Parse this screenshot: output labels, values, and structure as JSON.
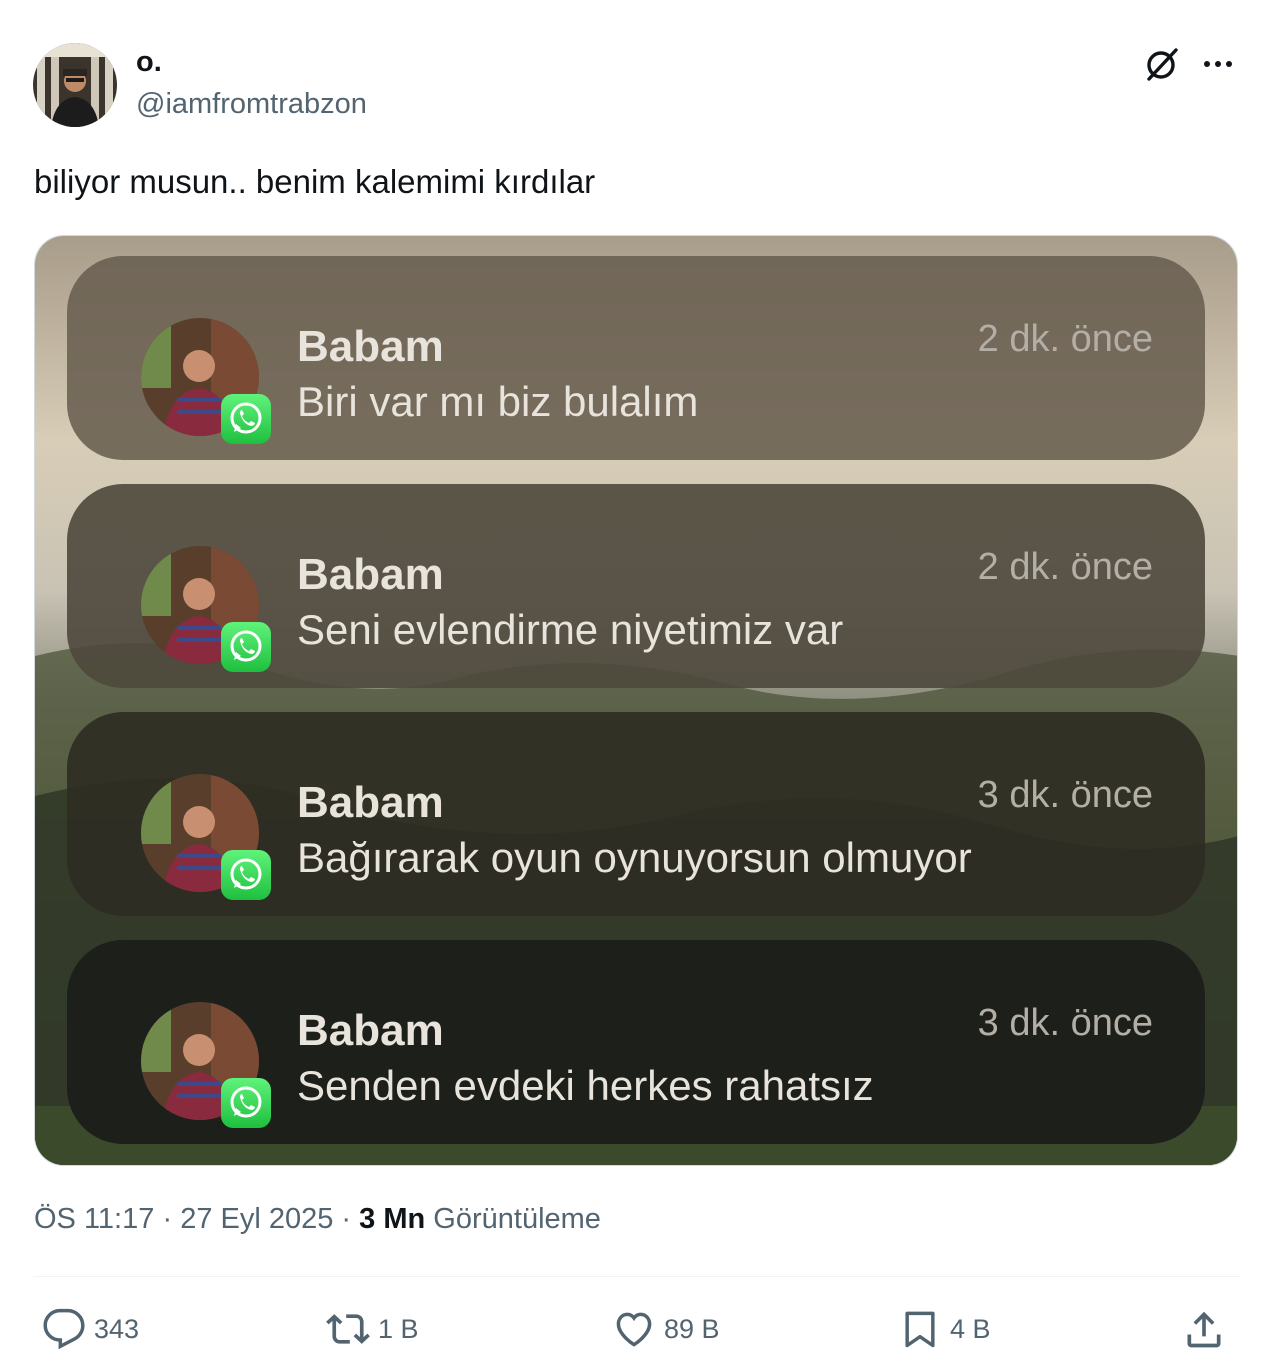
{
  "author": {
    "name": "o.",
    "handle": "@iamfromtrabzon"
  },
  "tweet": {
    "text": "biliyor musun.. benim kalemimi kırdılar"
  },
  "media": {
    "notifications": [
      {
        "sender": "Babam",
        "message": "Biri var mı biz bulalım",
        "time": "2 dk. önce",
        "app_icon": "whatsapp-icon"
      },
      {
        "sender": "Babam",
        "message": "Seni evlendirme niyetimiz var",
        "time": "2 dk. önce",
        "app_icon": "whatsapp-icon"
      },
      {
        "sender": "Babam",
        "message": "Bağırarak oyun oynuyorsun olmuyor",
        "time": "3 dk. önce",
        "app_icon": "whatsapp-icon"
      },
      {
        "sender": "Babam",
        "message": "Senden evdeki herkes rahatsız",
        "time": "3 dk. önce",
        "app_icon": "whatsapp-icon"
      }
    ]
  },
  "meta": {
    "time": "ÖS 11:17",
    "separator": "·",
    "date": "27 Eyl 2025",
    "views_count": "3 Mn",
    "views_label": "Görüntüleme"
  },
  "actions": {
    "replies": "343",
    "reposts": "1 B",
    "likes": "89 B",
    "bookmarks": "4 B"
  },
  "icons": [
    "grok-icon",
    "more-icon",
    "reply-icon",
    "repost-icon",
    "like-icon",
    "bookmark-icon",
    "share-icon"
  ]
}
